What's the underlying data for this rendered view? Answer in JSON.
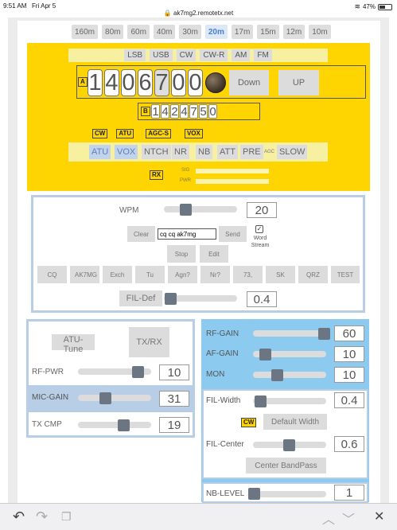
{
  "status": {
    "time": "9:51 AM",
    "date": "Fri Apr 5",
    "url": "ak7mg2.remotetx.net",
    "battery": "47%"
  },
  "bands": [
    "160m",
    "80m",
    "60m",
    "40m",
    "30m",
    "20m",
    "17m",
    "15m",
    "12m",
    "10m"
  ],
  "active_band": "20m",
  "modes": [
    "LSB",
    "USB",
    "CW",
    "CW-R",
    "AM",
    "FM"
  ],
  "vfoA": {
    "tag": "A",
    "digits": [
      "1",
      "4",
      "0",
      "6",
      "7",
      "0",
      "0"
    ],
    "down": "Down",
    "up": "UP"
  },
  "vfoB": {
    "tag": "B",
    "digits": [
      "1",
      "4",
      "2",
      "4",
      "7",
      "5",
      "0"
    ]
  },
  "indicators": [
    "CW",
    "ATU",
    "AGC-S",
    "VOX"
  ],
  "functions": {
    "atu": "ATU",
    "vox": "VOX",
    "ntch": "NTCH",
    "nr": "NR",
    "nb": "NB",
    "att": "ATT",
    "pre": "PRE",
    "agc": "AGC",
    "slow": "SLOW"
  },
  "rx_tag": "RX",
  "meters": {
    "sig": "SIG",
    "pwr": "PWR"
  },
  "colors": {
    "yellow": "#fed500",
    "panel_border": "#b8cde6",
    "blue_panel": "#8ccaf0",
    "active_blue": "#4a7fcf"
  },
  "cw": {
    "wpm_label": "WPM",
    "wpm_value": "20",
    "clear": "Clear",
    "message": "cq cq ak7mg",
    "send": "Send",
    "word_stream": "Word Stream",
    "stop": "Stop",
    "edit": "Edit",
    "macros": [
      "CQ",
      "AK7MG",
      "Exch",
      "Tu",
      "Agn?",
      "Nr?",
      "73,",
      "SK",
      "QRZ",
      "TEST"
    ],
    "fil_def": "FIL-Def",
    "fil_value": "0.4"
  },
  "left": {
    "atu_tune": "ATU-Tune",
    "txrx": "TX/RX",
    "rf_pwr": "RF-PWR",
    "rf_pwr_value": "10",
    "mic_gain": "MIC-GAIN",
    "mic_gain_value": "31",
    "tx_cmp": "TX CMP",
    "tx_cmp_value": "19"
  },
  "right": {
    "rf_gain": "RF-GAIN",
    "rf_gain_value": "60",
    "af_gain": "AF-GAIN",
    "af_gain_value": "10",
    "mon": "MON",
    "mon_value": "10",
    "fil_width": "FIL-Width",
    "fil_width_value": "0.4",
    "cw_tag": "CW",
    "default_width": "Default Width",
    "fil_center": "FIL-Center",
    "fil_center_value": "0.6",
    "center_bandpass": "Center BandPass",
    "nb_level": "NB-LEVEL",
    "nb_level_value": "1"
  }
}
